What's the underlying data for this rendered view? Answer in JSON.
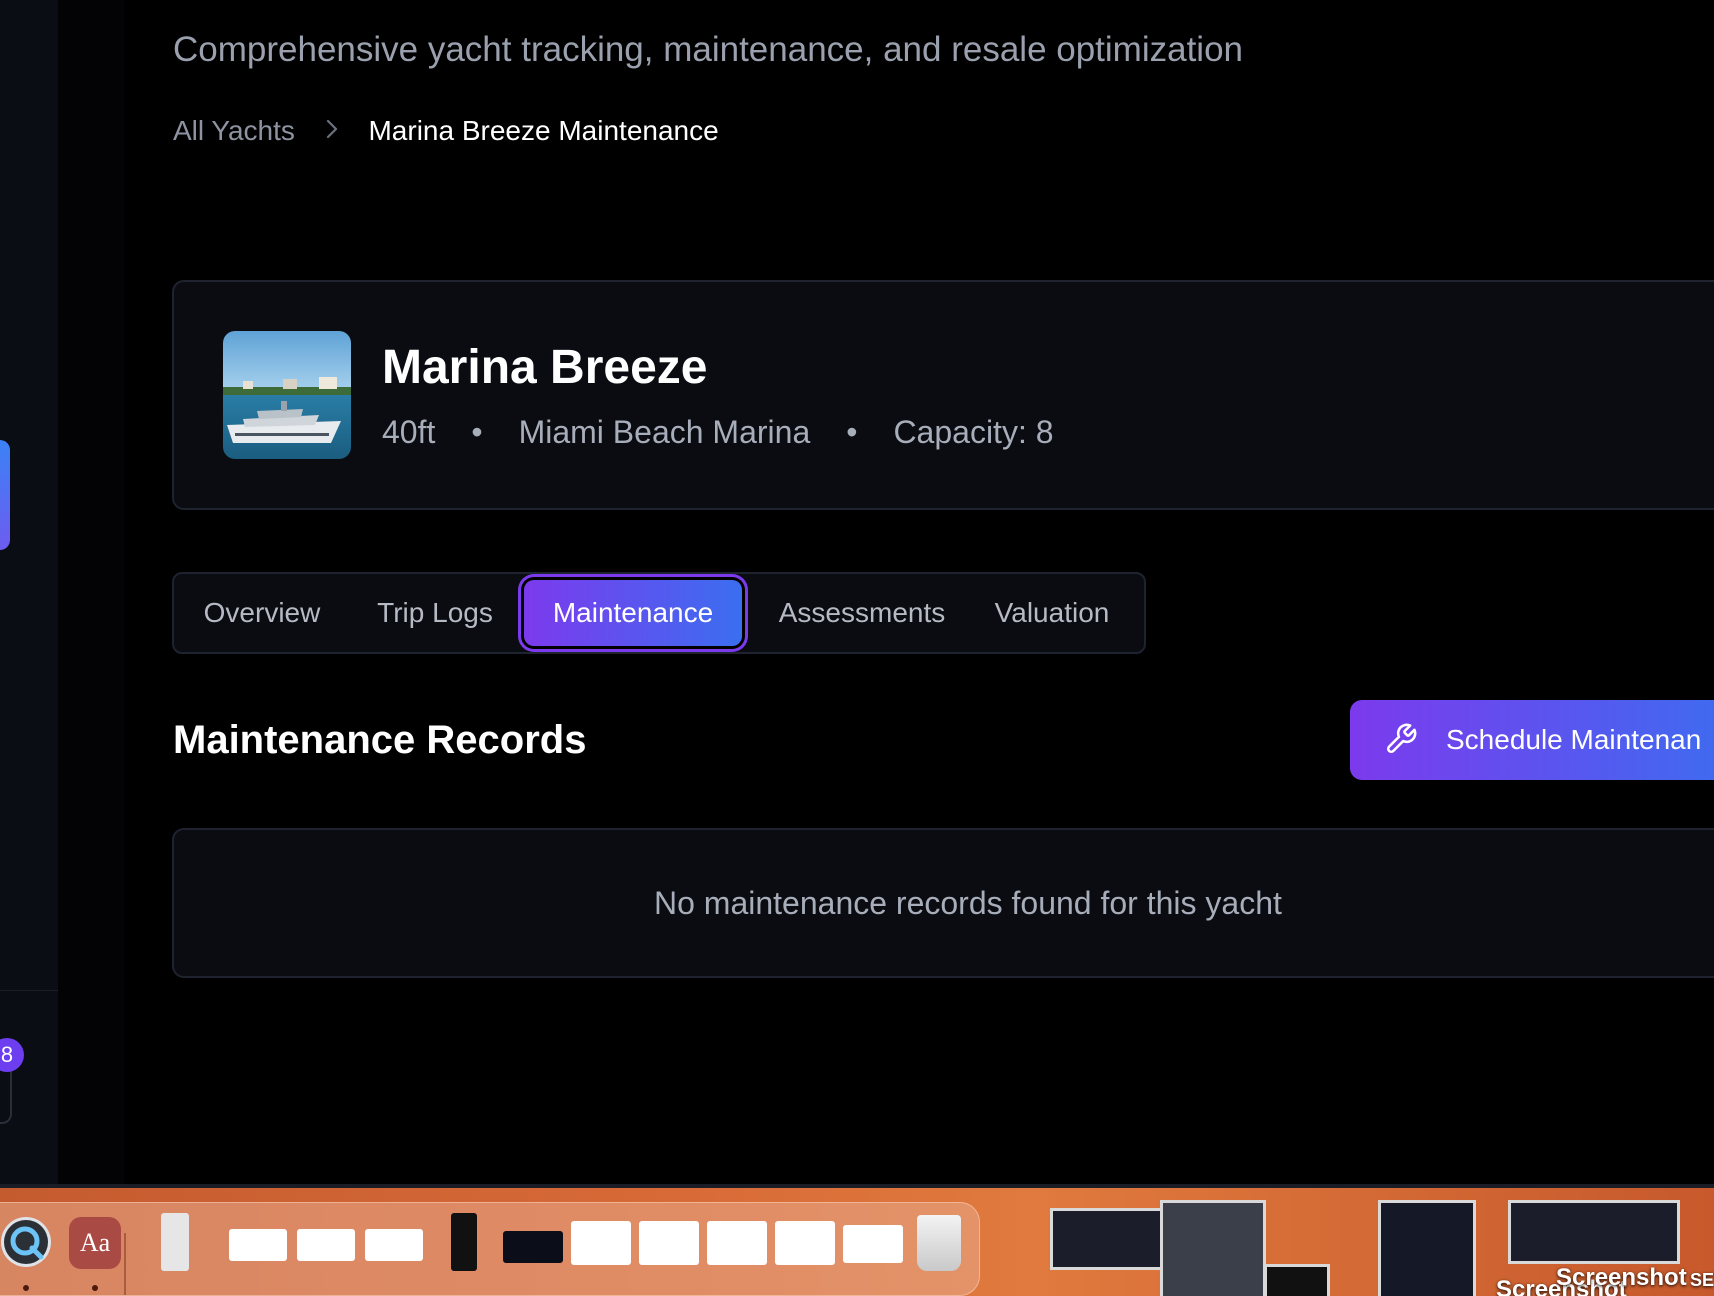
{
  "header": {
    "description": "Comprehensive yacht tracking, maintenance, and resale optimization"
  },
  "breadcrumb": {
    "root": "All Yachts",
    "current": "Marina Breeze Maintenance"
  },
  "yacht": {
    "name": "Marina Breeze",
    "length": "40ft",
    "marina": "Miami Beach Marina",
    "capacity": "Capacity: 8"
  },
  "tabs": [
    {
      "label": "Overview",
      "active": false
    },
    {
      "label": "Trip Logs",
      "active": false
    },
    {
      "label": "Maintenance",
      "active": true
    },
    {
      "label": "Assessments",
      "active": false
    },
    {
      "label": "Valuation",
      "active": false
    }
  ],
  "maintenance": {
    "title": "Maintenance Records",
    "schedule_button": "Schedule Maintenan",
    "empty_message": "No maintenance records found for this yacht"
  },
  "sidebar": {
    "badge": "8"
  },
  "dock": {
    "dictionary_label": "Aa",
    "desktop_labels": [
      "Screenshot",
      "Screenshot",
      "SEV"
    ]
  },
  "colors": {
    "accent_start": "#7c3aed",
    "accent_end": "#3b6ef0",
    "background": "#000000",
    "card": "#0a0c12"
  }
}
